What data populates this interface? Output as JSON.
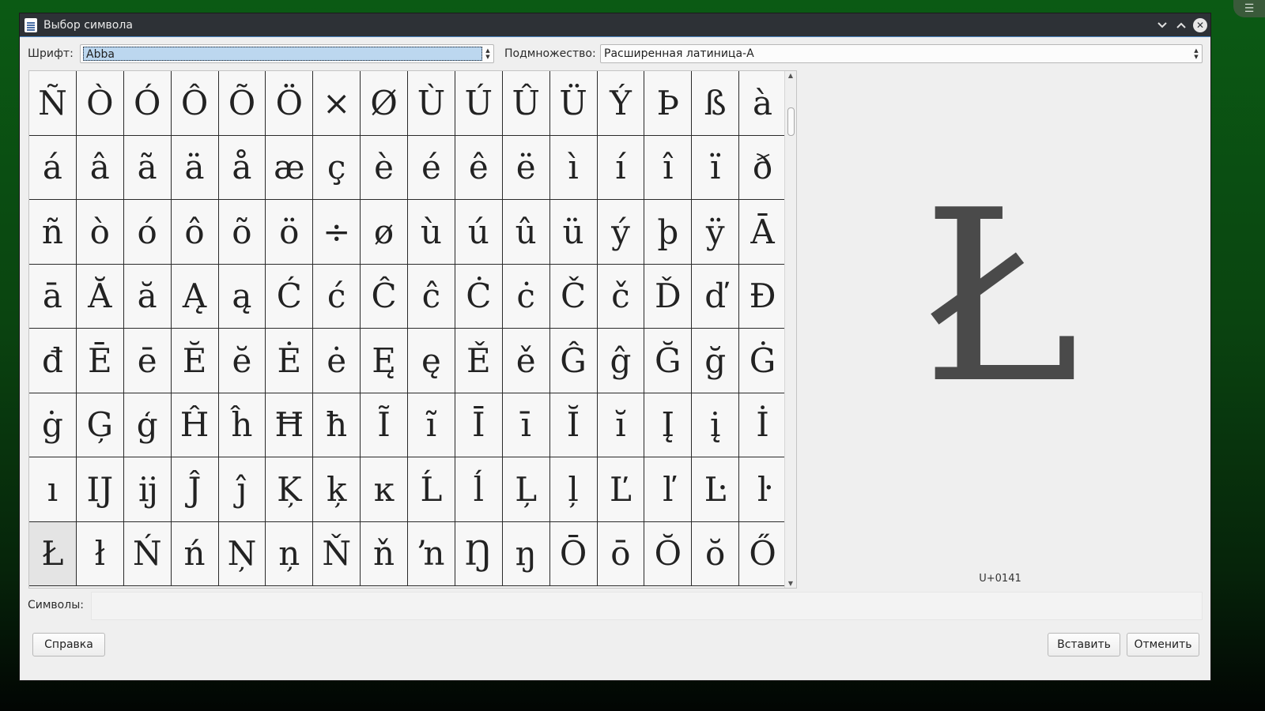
{
  "window": {
    "title": "Выбор символа",
    "titlebar_icons": [
      "document-icon",
      "chevron-down-icon",
      "chevron-up-icon",
      "close-icon"
    ]
  },
  "font": {
    "label": "Шрифт:",
    "value": "Abba"
  },
  "subset": {
    "label": "Подмножество:",
    "value": "Расширенная латиница-А"
  },
  "grid": {
    "columns": 16,
    "selected_index": 112,
    "chars": [
      "Ñ",
      "Ò",
      "Ó",
      "Ô",
      "Õ",
      "Ö",
      "×",
      "Ø",
      "Ù",
      "Ú",
      "Û",
      "Ü",
      "Ý",
      "Þ",
      "ß",
      "à",
      "á",
      "â",
      "ã",
      "ä",
      "å",
      "æ",
      "ç",
      "è",
      "é",
      "ê",
      "ë",
      "ì",
      "í",
      "î",
      "ï",
      "ð",
      "ñ",
      "ò",
      "ó",
      "ô",
      "õ",
      "ö",
      "÷",
      "ø",
      "ù",
      "ú",
      "û",
      "ü",
      "ý",
      "þ",
      "ÿ",
      "Ā",
      "ā",
      "Ă",
      "ă",
      "Ą",
      "ą",
      "Ć",
      "ć",
      "Ĉ",
      "ĉ",
      "Ċ",
      "ċ",
      "Č",
      "č",
      "Ď",
      "ď",
      "Đ",
      "đ",
      "Ē",
      "ē",
      "Ĕ",
      "ĕ",
      "Ė",
      "ė",
      "Ę",
      "ę",
      "Ě",
      "ě",
      "Ĝ",
      "ĝ",
      "Ğ",
      "ğ",
      "Ġ",
      "ġ",
      "Ģ",
      "ģ",
      "Ĥ",
      "ĥ",
      "Ħ",
      "ħ",
      "Ĩ",
      "ĩ",
      "Ī",
      "ī",
      "Ĭ",
      "ĭ",
      "Į",
      "į",
      "İ",
      "ı",
      "Ĳ",
      "ĳ",
      "Ĵ",
      "ĵ",
      "Ķ",
      "ķ",
      "ĸ",
      "Ĺ",
      "ĺ",
      "Ļ",
      "ļ",
      "Ľ",
      "ľ",
      "Ŀ",
      "ŀ",
      "Ł",
      "ł",
      "Ń",
      "ń",
      "Ņ",
      "ņ",
      "Ň",
      "ň",
      "ŉ",
      "Ŋ",
      "ŋ",
      "Ō",
      "ō",
      "Ŏ",
      "ŏ",
      "Ő"
    ]
  },
  "preview": {
    "char": "Ł",
    "codepoint": "U+0141"
  },
  "symbols": {
    "label": "Символы:",
    "value": ""
  },
  "buttons": {
    "help": "Справка",
    "insert": "Вставить",
    "cancel": "Отменить"
  }
}
